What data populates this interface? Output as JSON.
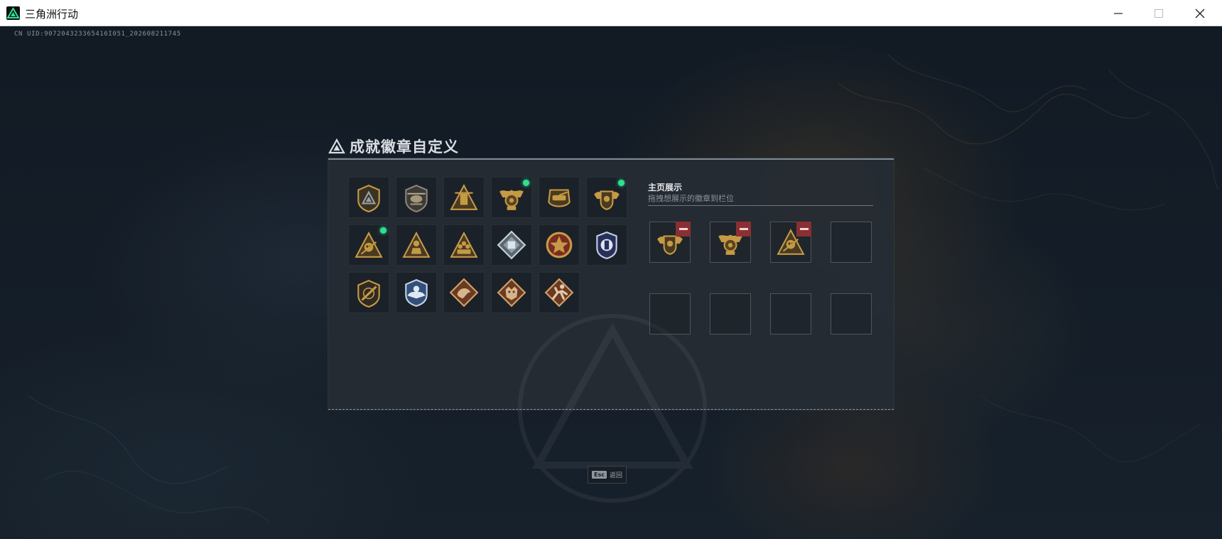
{
  "window": {
    "title": "三角洲行动",
    "controls": [
      "minimize-icon",
      "maximize-icon",
      "close-icon"
    ]
  },
  "uid_text": "CN UID:907204323365416I051_202608211745",
  "dialog": {
    "title": "成就徽章自定义",
    "badges": [
      {
        "icon": "triangle-shield-badge-icon",
        "new": false
      },
      {
        "icon": "helicopter-badge-icon",
        "new": false
      },
      {
        "icon": "tower-triangle-badge-icon",
        "new": false
      },
      {
        "icon": "eagle-crest-badge-icon",
        "new": true
      },
      {
        "icon": "tank-emblem-badge-icon",
        "new": false
      },
      {
        "icon": "winged-shield-badge-icon",
        "new": true
      },
      {
        "icon": "skull-triangle-badge-icon",
        "new": true
      },
      {
        "icon": "soldier-triangle-badge-icon",
        "new": false
      },
      {
        "icon": "squad-triangle-badge-icon",
        "new": false
      },
      {
        "icon": "silver-diamond-badge-icon",
        "new": false
      },
      {
        "icon": "star-medal-badge-icon",
        "new": false
      },
      {
        "icon": "blue-police-badge-icon",
        "new": false
      },
      {
        "icon": "rifle-shield-badge-icon",
        "new": false
      },
      {
        "icon": "blue-wing-badge-icon",
        "new": false
      },
      {
        "icon": "dragon-diamond-badge-icon",
        "new": false
      },
      {
        "icon": "beast-diamond-badge-icon",
        "new": false
      },
      {
        "icon": "runner-diamond-badge-icon",
        "new": false
      }
    ],
    "showcase": {
      "title": "主页展示",
      "hint": "拖拽想展示的徽章到栏位",
      "slots": [
        {
          "icon": "winged-shield-badge-icon",
          "filled": true
        },
        {
          "icon": "eagle-crest-badge-icon",
          "filled": true
        },
        {
          "icon": "skull-triangle-badge-icon",
          "filled": true
        },
        {
          "filled": false
        },
        {
          "filled": false
        },
        {
          "filled": false
        },
        {
          "filled": false
        },
        {
          "filled": false
        }
      ]
    }
  },
  "esc_hint": {
    "key": "Esc",
    "label": "返回"
  },
  "colors": {
    "gold": "#c59a45",
    "new_indicator": "#2fe08f",
    "remove": "#8a2f34",
    "panel": "#262c34"
  }
}
